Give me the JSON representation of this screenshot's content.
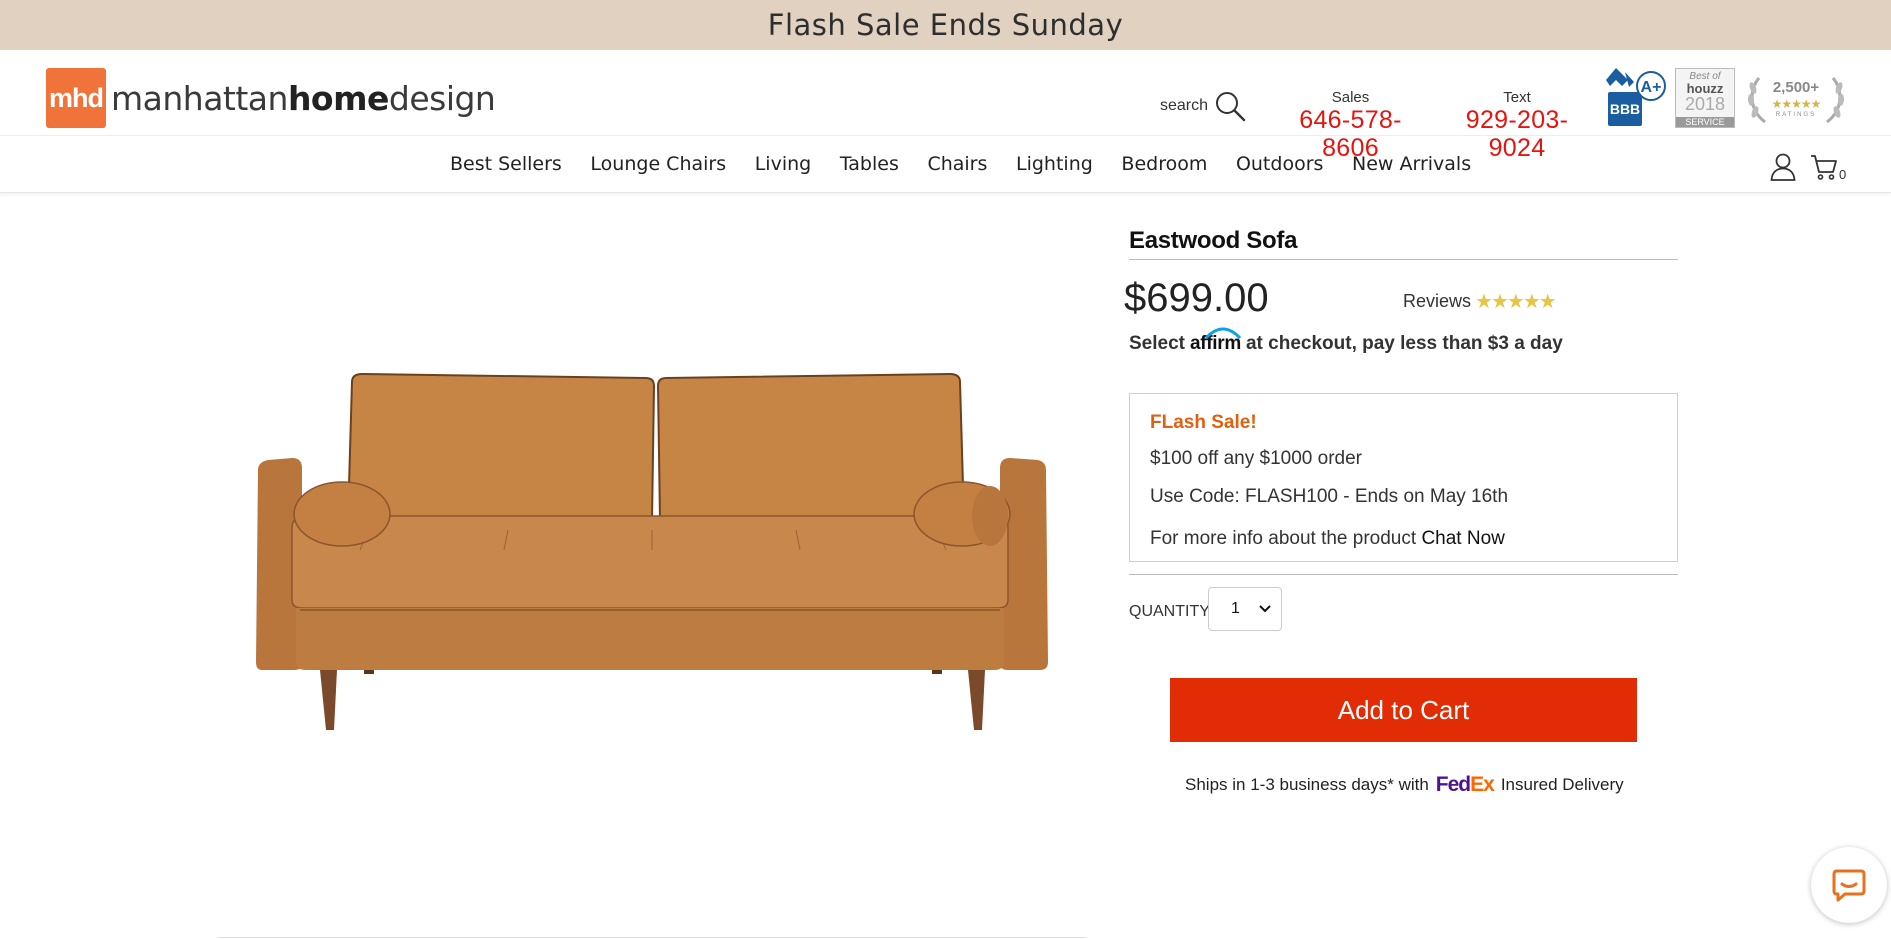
{
  "promo_bar": {
    "text": "Flash Sale Ends Sunday"
  },
  "header": {
    "logo_mark": "mhd",
    "logo_pre": "manhattan",
    "logo_bold": "home",
    "logo_post": "design",
    "search_label": "search",
    "sales_label": "Sales",
    "sales_number": "646-578-8606",
    "text_label": "Text",
    "text_number": "929-203-9024",
    "bbb_rating": "A+",
    "bbb_label": "BBB",
    "houzz_best_of": "Best of",
    "houzz_brand": "houzz",
    "houzz_year": "2018",
    "houzz_service": "SERVICE",
    "ratings_count": "2,500+",
    "ratings_stars": "★★★★★",
    "ratings_word": "RATINGS"
  },
  "nav": {
    "items": [
      "Best Sellers",
      "Lounge Chairs",
      "Living",
      "Tables",
      "Chairs",
      "Lighting",
      "Bedroom",
      "Outdoors",
      "New Arrivals"
    ],
    "cart_count": "0"
  },
  "product": {
    "title": "Eastwood Sofa",
    "price": "$699.00",
    "reviews_label": "Reviews",
    "reviews_stars": "★★★★★",
    "affirm_pre": "Select",
    "affirm_logo": "affirm",
    "affirm_post": "at checkout, pay less than $3 a day",
    "promo": {
      "heading": "FLash Sale!",
      "line1": "$100 off any $1000 order",
      "line2": "Use Code: FLASH100 - Ends on May 16th",
      "line3_pre": "For more info about the product ",
      "line3_link": "Chat Now"
    },
    "quantity_label": "QUANTITY:",
    "quantity_value": "1",
    "add_to_cart": "Add to Cart",
    "ship_pre": "Ships in 1-3 business days* with",
    "fedex_fe": "Fed",
    "fedex_ex": "Ex",
    "ship_post": "Insured Delivery"
  },
  "colors": {
    "promo_bar_bg": "#e0d1c0",
    "phone_red": "#e6140e",
    "add_to_cart_bg": "#e22c05",
    "flash_orange": "#e06010",
    "sofa_tan": "#c17f45"
  }
}
